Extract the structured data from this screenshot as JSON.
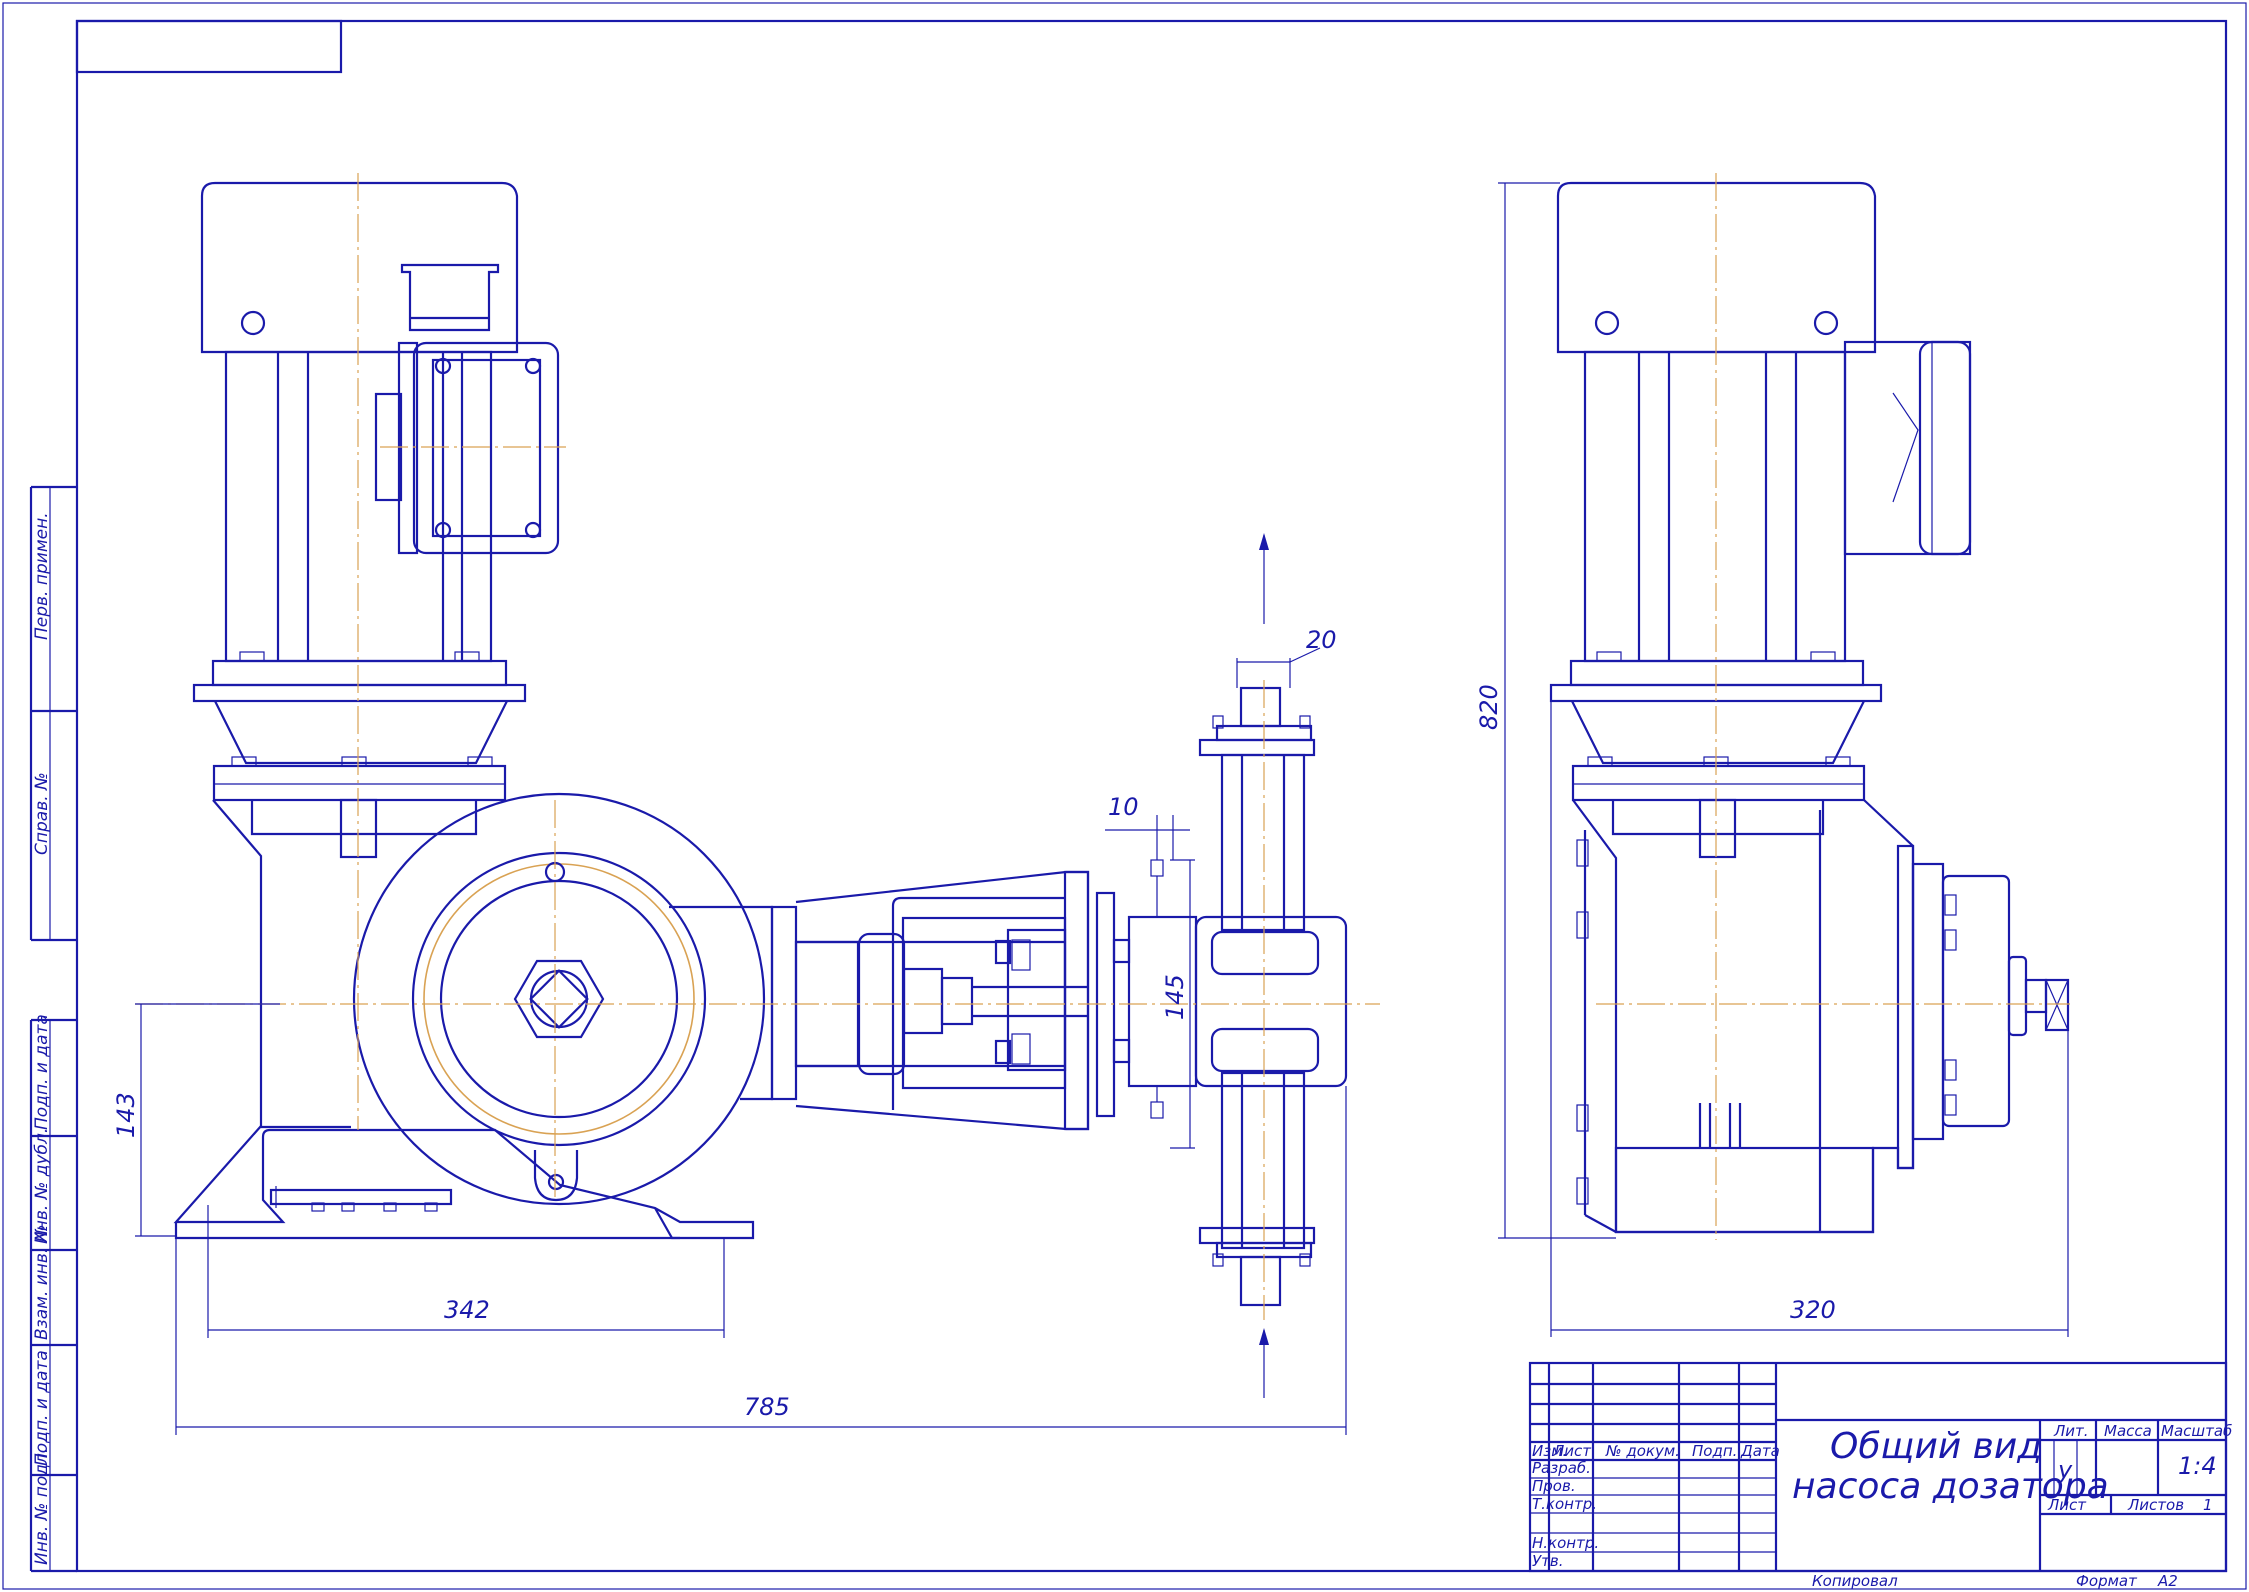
{
  "title_block": {
    "title_line1": "Общий вид",
    "title_line2": "насоса дозатора",
    "col_izm": "Изм.",
    "col_list": "Лист",
    "col_ndokum": "№ докум.",
    "col_podp": "Подп.",
    "col_data": "Дата",
    "row_razrab": "Разраб.",
    "row_prov": "Пров.",
    "row_tkontr": "Т.контр.",
    "row_nkontr": "Н.контр.",
    "row_utv": "Утв.",
    "lit_label": "Лит.",
    "massa_label": "Масса",
    "masshtab_label": "Масштаб",
    "lit_value": "у",
    "scale_value": "1:4",
    "sheet_label": "Лист",
    "sheets_label": "Листов",
    "sheets_value": "1",
    "copied_label": "Копировал",
    "format_label": "Формат",
    "format_value": "A2"
  },
  "side_stamp": {
    "perv_primen": "Перв. примен.",
    "sprav_no": "Справ. №",
    "podp_data_1": "Подп. и дата",
    "inv_dubl": "Инв. № дубл.",
    "vzam_inv": "Взам. инв. №",
    "podp_data_2": "Подп. и дата",
    "inv_podl": "Инв. № подл."
  },
  "dimensions": {
    "d20": "20",
    "d10": "10",
    "d145": "145",
    "d143": "143",
    "d342": "342",
    "d785": "785",
    "d820": "820",
    "d320": "320"
  },
  "colors": {
    "line": "#1a1aaa",
    "axis": "#d9a253",
    "paper": "#ffffff"
  }
}
